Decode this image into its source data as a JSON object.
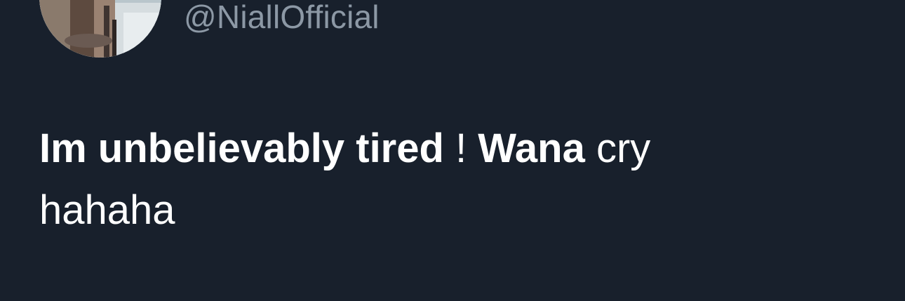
{
  "tweet": {
    "handle": "@NiallOfficial",
    "text_segments": {
      "seg1": "Im unbelievably tired",
      "seg2": " ! ",
      "seg3": "Wana",
      "seg4": " cry",
      "seg5": "hahaha"
    }
  },
  "colors": {
    "background": "#18202c",
    "handle": "#8c98a5",
    "text": "#ffffff"
  }
}
